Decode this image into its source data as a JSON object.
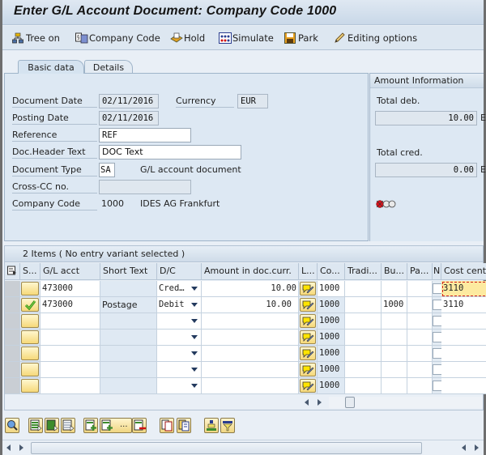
{
  "window": {
    "title": "Enter G/L Account Document: Company Code 1000"
  },
  "toolbar": {
    "buttons": [
      {
        "label": "Tree on",
        "icon": "tree-icon"
      },
      {
        "label": "Company Code",
        "icon": "company-code-icon"
      },
      {
        "label": "Hold",
        "icon": "hold-icon"
      },
      {
        "label": "Simulate",
        "icon": "simulate-icon"
      },
      {
        "label": "Park",
        "icon": "park-save-icon"
      },
      {
        "label": "Editing options",
        "icon": "pencil-icon"
      }
    ]
  },
  "tabs": [
    {
      "label": "Basic data",
      "active": true
    },
    {
      "label": "Details",
      "active": false
    }
  ],
  "header": {
    "document_date": {
      "label": "Document Date",
      "value": "02/11/2016"
    },
    "currency": {
      "label": "Currency",
      "value": "EUR"
    },
    "posting_date": {
      "label": "Posting Date",
      "value": "02/11/2016"
    },
    "reference": {
      "label": "Reference",
      "value": "REF"
    },
    "doc_header_text": {
      "label": "Doc.Header Text",
      "value": "DOC Text"
    },
    "document_type": {
      "label": "Document Type",
      "value": "SA",
      "description": "G/L account document"
    },
    "cross_cc": {
      "label": "Cross-CC no.",
      "value": ""
    },
    "company_code": {
      "label": "Company Code",
      "value": "1000",
      "description": "IDES AG Frankfurt"
    }
  },
  "amount_info": {
    "title": "Amount Information",
    "total_debit": {
      "label": "Total deb.",
      "value": "10.00",
      "unit": "E"
    },
    "total_credit": {
      "label": "Total cred.",
      "value": "0.00",
      "unit": "E"
    },
    "status_light": "red"
  },
  "items": {
    "title": "2 Items ( No entry variant selected )",
    "columns": [
      "S...",
      "G/L acct",
      "Short Text",
      "D/C",
      "Amount in doc.curr.",
      "L...",
      "Co...",
      "Tradi...",
      "Bu...",
      "Pa...",
      "N",
      "Cost cent"
    ],
    "rows": [
      {
        "status": "",
        "gl_acct": "473000",
        "short_text": "",
        "dc": "Cred…",
        "amount": "10.00",
        "co": "1000",
        "trading": "",
        "bu": "",
        "pa": "",
        "cost_center": "3110"
      },
      {
        "status": "ok",
        "gl_acct": "473000",
        "short_text": "Postage",
        "dc": "Debit",
        "amount": "10.00",
        "co": "1000",
        "trading": "",
        "bu": "1000",
        "pa": "",
        "cost_center": "3110"
      },
      {
        "status": "",
        "gl_acct": "",
        "short_text": "",
        "dc": "",
        "amount": "",
        "co": "1000",
        "trading": "",
        "bu": "",
        "pa": "",
        "cost_center": ""
      },
      {
        "status": "",
        "gl_acct": "",
        "short_text": "",
        "dc": "",
        "amount": "",
        "co": "1000",
        "trading": "",
        "bu": "",
        "pa": "",
        "cost_center": ""
      },
      {
        "status": "",
        "gl_acct": "",
        "short_text": "",
        "dc": "",
        "amount": "",
        "co": "1000",
        "trading": "",
        "bu": "",
        "pa": "",
        "cost_center": ""
      },
      {
        "status": "",
        "gl_acct": "",
        "short_text": "",
        "dc": "",
        "amount": "",
        "co": "1000",
        "trading": "",
        "bu": "",
        "pa": "",
        "cost_center": ""
      },
      {
        "status": "",
        "gl_acct": "",
        "short_text": "",
        "dc": "",
        "amount": "",
        "co": "1000",
        "trading": "",
        "bu": "",
        "pa": "",
        "cost_center": ""
      }
    ]
  },
  "bottom_toolbar": {
    "buttons": [
      "details-icon",
      "select-all-icon",
      "select-block-icon",
      "deselect-all-icon",
      "insert-row-icon",
      "insert-rows-icon",
      "delete-row-icon",
      "copy-icon",
      "paste-icon",
      "sort-icon",
      "filter-icon"
    ],
    "more_label": "..."
  }
}
